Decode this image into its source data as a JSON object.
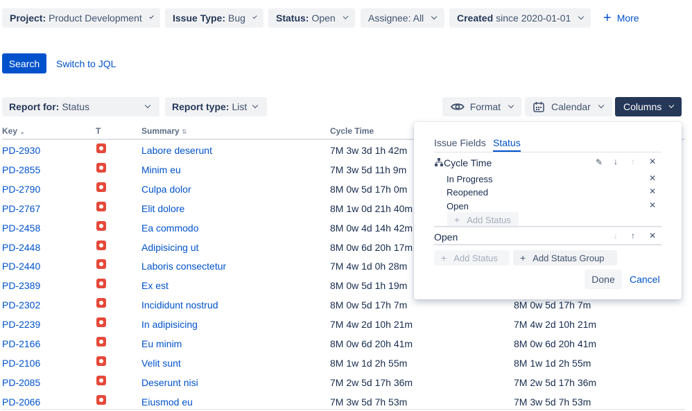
{
  "filters": [
    {
      "label": "Project:",
      "value": "Product Development"
    },
    {
      "label": "Issue Type:",
      "value": "Bug"
    },
    {
      "label": "Status:",
      "value": "Open"
    },
    {
      "label": "",
      "value": "Assignee: All"
    },
    {
      "label": "Created",
      "value": "since 2020-01-01"
    }
  ],
  "more_label": "More",
  "search_label": "Search",
  "switch_jql_label": "Switch to JQL",
  "report_for": {
    "label": "Report for:",
    "value": "Status"
  },
  "report_type": {
    "label": "Report type:",
    "value": "List"
  },
  "toolbar": {
    "format": "Format",
    "calendar": "Calendar",
    "columns": "Columns"
  },
  "table": {
    "headers": {
      "key": "Key",
      "type": "T",
      "summary": "Summary",
      "cycle": "Cycle Time"
    },
    "rows": [
      {
        "key": "PD-2930",
        "summary": "Labore deserunt",
        "cycle": "7M 3w 3d 1h 42m",
        "cycle2": ""
      },
      {
        "key": "PD-2855",
        "summary": "Minim eu",
        "cycle": "7M 3w 5d 11h 9m",
        "cycle2": ""
      },
      {
        "key": "PD-2790",
        "summary": "Culpa dolor",
        "cycle": "8M 0w 5d 17h 0m",
        "cycle2": ""
      },
      {
        "key": "PD-2767",
        "summary": "Elit dolore",
        "cycle": "8M 1w 0d 21h 40m",
        "cycle2": ""
      },
      {
        "key": "PD-2458",
        "summary": "Ea commodo",
        "cycle": "8M 0w 4d 14h 42m",
        "cycle2": ""
      },
      {
        "key": "PD-2448",
        "summary": "Adipisicing ut",
        "cycle": "8M 0w 6d 20h 17m",
        "cycle2": ""
      },
      {
        "key": "PD-2440",
        "summary": "Laboris consectetur",
        "cycle": "7M 4w 1d 0h 28m",
        "cycle2": ""
      },
      {
        "key": "PD-2389",
        "summary": "Ex est",
        "cycle": "8M 0w 5d 1h 19m",
        "cycle2": ""
      },
      {
        "key": "PD-2302",
        "summary": "Incididunt nostrud",
        "cycle": "8M 0w 5d 17h 7m",
        "cycle2": "8M 0w 5d 17h 7m"
      },
      {
        "key": "PD-2239",
        "summary": "In adipisicing",
        "cycle": "7M 4w 2d 10h 21m",
        "cycle2": "7M 4w 2d 10h 21m"
      },
      {
        "key": "PD-2166",
        "summary": "Eu minim",
        "cycle": "8M 0w 6d 20h 41m",
        "cycle2": "8M 0w 6d 20h 41m"
      },
      {
        "key": "PD-2106",
        "summary": "Velit sunt",
        "cycle": "8M 1w 1d 2h 55m",
        "cycle2": "8M 1w 1d 2h 55m"
      },
      {
        "key": "PD-2085",
        "summary": "Deserunt nisi",
        "cycle": "7M 2w 5d 17h 36m",
        "cycle2": "7M 2w 5d 17h 36m"
      },
      {
        "key": "PD-2066",
        "summary": "Eiusmod eu",
        "cycle": "7M 3w 5d 7h 53m",
        "cycle2": "7M 3w 5d 7h 53m"
      }
    ]
  },
  "popup": {
    "tabs": [
      "Issue Fields",
      "Status"
    ],
    "group1": {
      "title": "Cycle Time",
      "statuses": [
        "In Progress",
        "Reopened",
        "Open"
      ],
      "add_status": "Add Status"
    },
    "group2": {
      "title": "Open"
    },
    "add_status": "Add Status",
    "add_group": "Add Status Group",
    "done": "Done",
    "cancel": "Cancel"
  },
  "colors": {
    "primary": "#0052cc",
    "dark": "#253858",
    "bug": "#e5493a"
  }
}
